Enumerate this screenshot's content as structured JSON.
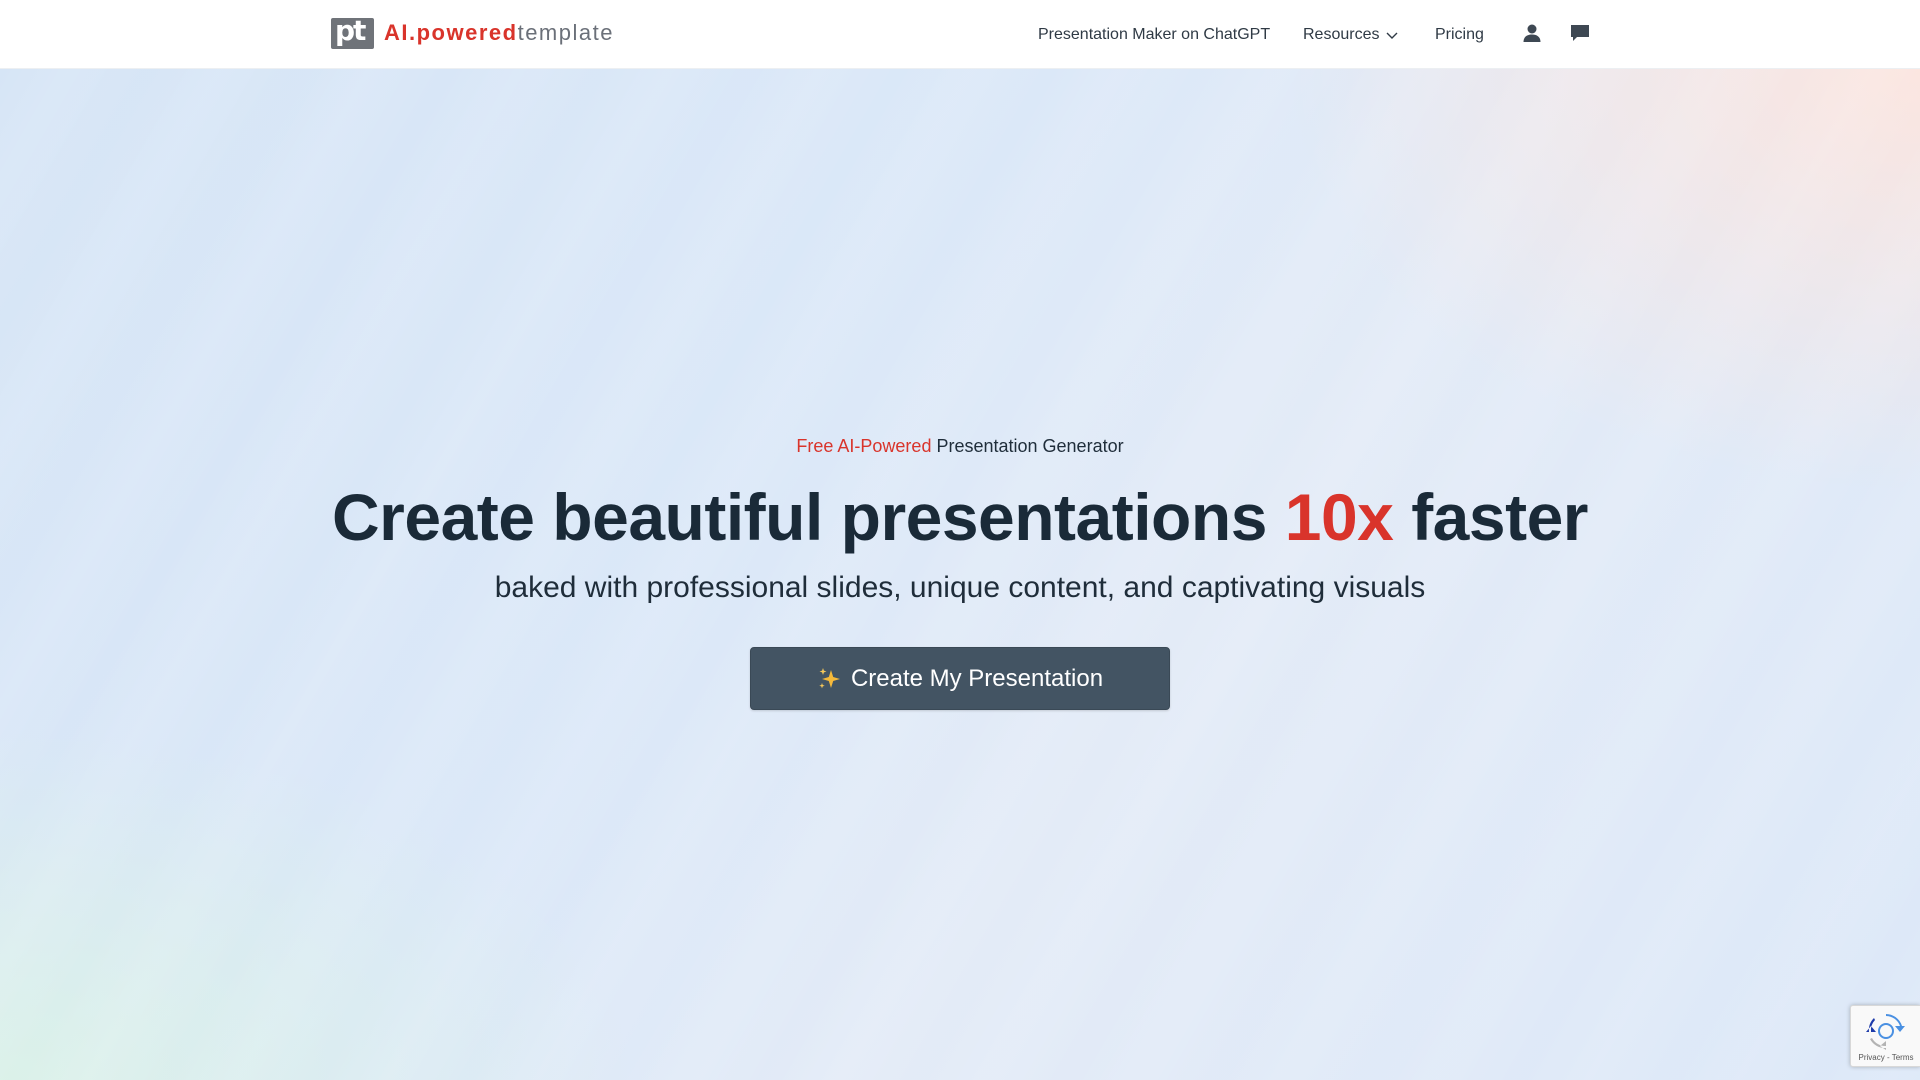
{
  "header": {
    "logo": {
      "mark_text": "pt",
      "brand_part1": "AI.powered",
      "brand_part2": "template"
    },
    "nav": [
      {
        "label": "Presentation Maker on ChatGPT"
      },
      {
        "label": "Resources",
        "has_dropdown": true
      },
      {
        "label": "Pricing"
      }
    ],
    "icons": [
      "user-icon",
      "chat-icon"
    ]
  },
  "hero": {
    "eyebrow_accent": "Free AI-Powered",
    "eyebrow_rest": "Presentation Generator",
    "headline_before": "Create beautiful presentations ",
    "headline_accent": "10x",
    "headline_after": " faster",
    "subhead": "baked with professional slides, unique content, and captivating visuals",
    "cta_label": "Create My Presentation",
    "cta_icon": "sparkle-icon"
  },
  "recaptcha": {
    "links": "Privacy - Terms"
  },
  "colors": {
    "accent": "#d9342b",
    "text_dark": "#1a2a38",
    "button_bg": "#435463",
    "logo_gray": "#6f7379"
  }
}
